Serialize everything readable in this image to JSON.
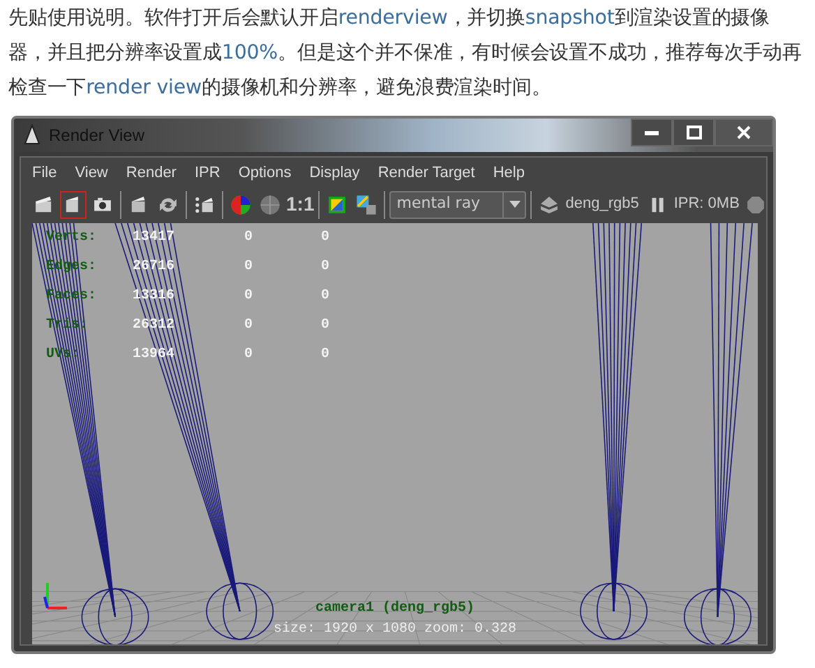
{
  "intro": {
    "segments": [
      {
        "text": "先贴使用说明。软件打开后会默认开启",
        "link": false
      },
      {
        "text": "renderview",
        "link": true
      },
      {
        "text": "，并切换",
        "link": false
      },
      {
        "text": "snapshot",
        "link": true
      },
      {
        "text": "到渲染设置的摄像器，并且把分辨率设置成",
        "link": false
      },
      {
        "text": "100%",
        "link": true
      },
      {
        "text": "。但是这个并不保准，有时候会设置不成功，推荐每次手动再检查一下",
        "link": false
      },
      {
        "text": "render view",
        "link": true
      },
      {
        "text": "的摄像机和分辨率，避免浪费渲染时间。",
        "link": false
      }
    ]
  },
  "window": {
    "title": "Render View",
    "menu": [
      "File",
      "View",
      "Render",
      "IPR",
      "Options",
      "Display",
      "Render Target",
      "Help"
    ],
    "toolbar": [
      [
        {
          "kind": "icon",
          "selected": false
        },
        {
          "kind": "icon",
          "selected": true
        },
        {
          "kind": "icon",
          "selected": false
        }
      ],
      [
        {
          "kind": "icon",
          "selected": false
        },
        {
          "kind": "icon",
          "selected": false
        }
      ],
      [
        {
          "kind": "icon",
          "selected": false
        }
      ],
      [
        {
          "kind": "icon",
          "selected": false
        },
        {
          "kind": "icon",
          "selected": false
        },
        {
          "kind": "label",
          "text": "1:1"
        }
      ],
      [
        {
          "kind": "icon",
          "selected": false
        },
        {
          "kind": "icon",
          "selected": false
        }
      ],
      [
        {
          "kind": "dropdown",
          "value": "mental ray"
        }
      ],
      [
        {
          "kind": "icon",
          "selected": false
        },
        {
          "kind": "label",
          "text": "deng_rgb5"
        },
        {
          "kind": "spacer"
        },
        {
          "kind": "icon",
          "selected": false
        },
        {
          "kind": "label",
          "text": "IPR: 0MB"
        },
        {
          "kind": "icon",
          "selected": false
        }
      ]
    ],
    "stats": [
      {
        "label": "Verts:",
        "values": [
          "13417",
          "0",
          "0"
        ]
      },
      {
        "label": "Edges:",
        "values": [
          "26716",
          "0",
          "0"
        ]
      },
      {
        "label": "Faces:",
        "values": [
          "13316",
          "0",
          "0"
        ]
      },
      {
        "label": "Tris:",
        "values": [
          "26312",
          "0",
          "0"
        ]
      },
      {
        "label": "UVs:",
        "values": [
          "13964",
          "0",
          "0"
        ]
      }
    ],
    "camera_caption": "camera1 (deng_rgb5)",
    "size_caption": "size: 1920 x 1080  zoom: 0.328"
  }
}
